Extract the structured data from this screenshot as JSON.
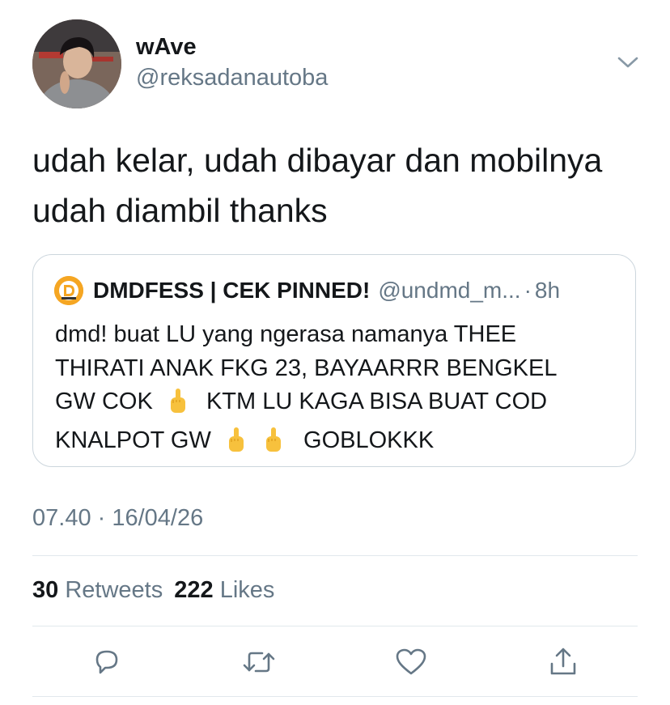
{
  "tweet": {
    "author": {
      "display_name": "wAve",
      "handle": "@reksadanautoba"
    },
    "text_line1": "udah kelar, udah dibayar dan mobilnya",
    "text_line2": "udah diambil thanks",
    "quote": {
      "author_name": "DMDFESS | CEK PINNED!",
      "author_handle": "@undmd_m...",
      "separator": "·",
      "time_ago": "8h",
      "line1": "dmd! buat LU yang ngerasa namanya THEE",
      "line2": "THIRATI ANAK FKG 23, BAYAARRR BENGKEL",
      "line3_a": "GW COK",
      "line3_b": "KTM LU KAGA BISA BUAT COD",
      "line4_a": "KNALPOT GW",
      "line4_b": "GOBLOKKK",
      "emoji": "middle-finger"
    },
    "timestamp": "07.40 · 16/04/26",
    "stats": {
      "retweets_count": "30",
      "retweets_label": "Retweets",
      "likes_count": "222",
      "likes_label": "Likes"
    },
    "actions": {
      "reply_icon": "reply-icon",
      "retweet_icon": "retweet-icon",
      "like_icon": "heart-icon",
      "share_icon": "share-icon"
    }
  },
  "colors": {
    "text_primary": "#14171a",
    "text_secondary": "#657786",
    "border": "#ccd6dd",
    "divider": "#e1e8ed",
    "quote_avatar": "#f39c12"
  }
}
